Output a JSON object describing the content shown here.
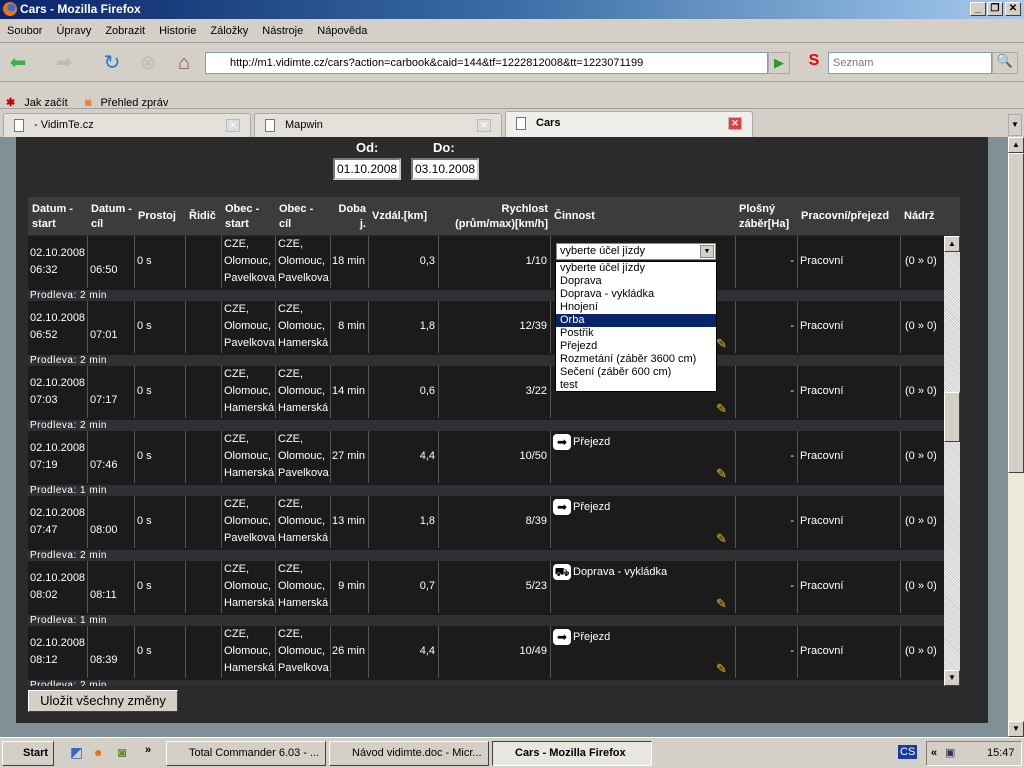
{
  "window": {
    "title": "Cars - Mozilla Firefox",
    "min": "_",
    "max": "❐",
    "close": "✕"
  },
  "menu": [
    "Soubor",
    "Úpravy",
    "Zobrazit",
    "Historie",
    "Záložky",
    "Nástroje",
    "Nápověda"
  ],
  "nav": {
    "url": "http://m1.vidimte.cz/cars?action=carbook&caid=144&tf=1222812008&tt=1223071199",
    "search_placeholder": "Seznam"
  },
  "bookmarks": [
    "Jak začít",
    "Přehled zpráv"
  ],
  "tabs": [
    {
      "label": "- VidimTe.cz"
    },
    {
      "label": "Mapwin"
    },
    {
      "label": "Cars",
      "active": true
    }
  ],
  "filter": {
    "from_label": "Od:",
    "from_value": "01.10.2008",
    "to_label": "Do:",
    "to_value": "03.10.2008"
  },
  "columns": [
    "Datum - start",
    "Datum - cíl",
    "Prostoj",
    "Řidič",
    "Obec - start",
    "Obec - cíl",
    "Doba j.",
    "Vzdál.[km]",
    "Rychlost (prům/max)[km/h]",
    "Činnost",
    "Plošný záběr[Ha]",
    "Pracovní/přejezd",
    "Nádrž"
  ],
  "rows": [
    {
      "start_date": "02.10.2008",
      "start_time": "06:32",
      "end_time": "06:50",
      "idle": "0 s",
      "driver": "",
      "from": [
        "CZE,",
        "Olomouc,",
        "Pavelkova"
      ],
      "to": [
        "CZE,",
        "Olomouc,",
        "Pavelkova"
      ],
      "duration": "18 min",
      "distance": "0,3",
      "speed": "1/10",
      "activity": "",
      "activity_icon": "",
      "area": "-",
      "mode": "Pracovní",
      "tank": "(0 » 0)",
      "pause": "Prodleva: 2 min"
    },
    {
      "start_date": "02.10.2008",
      "start_time": "06:52",
      "end_time": "07:01",
      "idle": "0 s",
      "driver": "",
      "from": [
        "CZE,",
        "Olomouc,",
        "Pavelkova"
      ],
      "to": [
        "CZE,",
        "Olomouc,",
        "Hamerská"
      ],
      "duration": "8 min",
      "distance": "1,8",
      "speed": "12/39",
      "activity": "",
      "activity_icon": "",
      "area": "-",
      "mode": "Pracovní",
      "tank": "(0 » 0)",
      "pause": "Prodleva: 2 min"
    },
    {
      "start_date": "02.10.2008",
      "start_time": "07:03",
      "end_time": "07:17",
      "idle": "0 s",
      "driver": "",
      "from": [
        "CZE,",
        "Olomouc,",
        "Hamerská"
      ],
      "to": [
        "CZE,",
        "Olomouc,",
        "Hamerská"
      ],
      "duration": "14 min",
      "distance": "0,6",
      "speed": "3/22",
      "activity": "",
      "activity_icon": "",
      "area": "-",
      "mode": "Pracovní",
      "tank": "(0 » 0)",
      "pause": "Prodleva: 2 min"
    },
    {
      "start_date": "02.10.2008",
      "start_time": "07:19",
      "end_time": "07:46",
      "idle": "0 s",
      "driver": "",
      "from": [
        "CZE,",
        "Olomouc,",
        "Hamerská"
      ],
      "to": [
        "CZE,",
        "Olomouc,",
        "Pavelkova"
      ],
      "duration": "27 min",
      "distance": "4,4",
      "speed": "10/50",
      "activity": "Přejezd",
      "activity_icon": "arrow-right-icon",
      "area": "-",
      "mode": "Pracovní",
      "tank": "(0 » 0)",
      "pause": "Prodleva: 1 min"
    },
    {
      "start_date": "02.10.2008",
      "start_time": "07:47",
      "end_time": "08:00",
      "idle": "0 s",
      "driver": "",
      "from": [
        "CZE,",
        "Olomouc,",
        "Pavelkova"
      ],
      "to": [
        "CZE,",
        "Olomouc,",
        "Hamerská"
      ],
      "duration": "13 min",
      "distance": "1,8",
      "speed": "8/39",
      "activity": "Přejezd",
      "activity_icon": "arrow-right-icon",
      "area": "-",
      "mode": "Pracovní",
      "tank": "(0 » 0)",
      "pause": "Prodleva: 2 min"
    },
    {
      "start_date": "02.10.2008",
      "start_time": "08:02",
      "end_time": "08:11",
      "idle": "0 s",
      "driver": "",
      "from": [
        "CZE,",
        "Olomouc,",
        "Hamerská"
      ],
      "to": [
        "CZE,",
        "Olomouc,",
        "Hamerská"
      ],
      "duration": "9 min",
      "distance": "0,7",
      "speed": "5/23",
      "activity": "Doprava - vykládka",
      "activity_icon": "truck-icon",
      "area": "-",
      "mode": "Pracovní",
      "tank": "(0 » 0)",
      "pause": "Prodleva: 1 min"
    },
    {
      "start_date": "02.10.2008",
      "start_time": "08:12",
      "end_time": "08:39",
      "idle": "0 s",
      "driver": "",
      "from": [
        "CZE,",
        "Olomouc,",
        "Hamerská"
      ],
      "to": [
        "CZE,",
        "Olomouc,",
        "Pavelkova"
      ],
      "duration": "26 min",
      "distance": "4,4",
      "speed": "10/49",
      "activity": "Přejezd",
      "activity_icon": "arrow-right-icon",
      "area": "-",
      "mode": "Pracovní",
      "tank": "(0 » 0)",
      "pause": "Prodleva: 2 min"
    }
  ],
  "select": {
    "value": "vyberte účel jízdy",
    "options": [
      "vyberte účel jízdy",
      "Doprava",
      "Doprava - vykládka",
      "Hnojení",
      "Orba",
      "Postřik",
      "Přejezd",
      "Rozmetání (záběr 3600 cm)",
      "Sečení (záběr 600 cm)",
      "test"
    ],
    "highlighted": "Orba"
  },
  "save_label": "Uložit všechny změny",
  "taskbar": {
    "start": "Start",
    "chevron": "»",
    "items": [
      "Total Commander 6.03 - ...",
      "Návod vidimte.doc - Micr...",
      "Cars - Mozilla Firefox"
    ],
    "lang": "CS",
    "tray_chevron": "«",
    "clock": "15:47"
  },
  "colors": {
    "panel": "#2b2b2b",
    "row": "#1b1b1b",
    "highlight": "#0a246a"
  }
}
